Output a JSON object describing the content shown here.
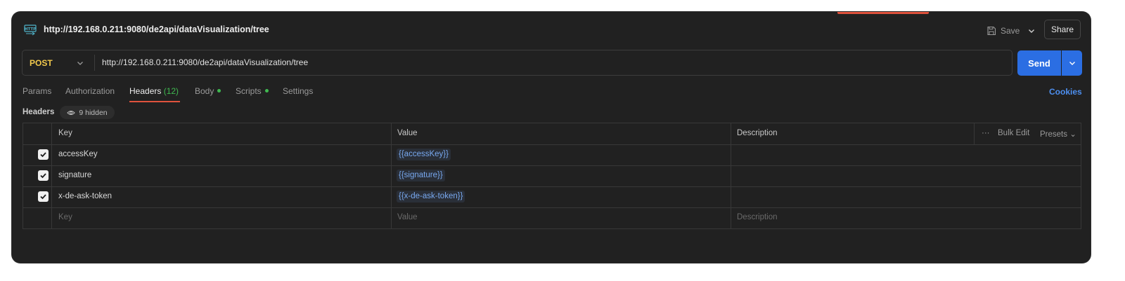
{
  "title": "http://192.168.0.211:9080/de2api/dataVisualization/tree",
  "toolbar": {
    "save_label": "Save",
    "share_label": "Share"
  },
  "request": {
    "method": "POST",
    "url": "http://192.168.0.211:9080/de2api/dataVisualization/tree",
    "send_label": "Send"
  },
  "tabs": [
    {
      "label": "Params"
    },
    {
      "label": "Authorization"
    },
    {
      "label": "Headers",
      "count": "(12)",
      "active": true
    },
    {
      "label": "Body",
      "dot": true
    },
    {
      "label": "Scripts",
      "dot": true
    },
    {
      "label": "Settings"
    }
  ],
  "cookies_label": "Cookies",
  "headers_section": {
    "label": "Headers",
    "hidden_label": "9 hidden"
  },
  "table": {
    "columns": {
      "key": "Key",
      "value": "Value",
      "description": "Description"
    },
    "tools": {
      "bulk_edit": "Bulk Edit",
      "presets": "Presets"
    },
    "rows": [
      {
        "checked": true,
        "key": "accessKey",
        "value": "{{accessKey}}"
      },
      {
        "checked": true,
        "key": "signature",
        "value": "{{signature}}"
      },
      {
        "checked": true,
        "key": "x-de-ask-token",
        "value": "{{x-de-ask-token}}"
      }
    ],
    "placeholders": {
      "key": "Key",
      "value": "Value",
      "description": "Description"
    }
  },
  "colors": {
    "background": "#212121",
    "accent": "#e0533d",
    "send": "#2b6ee3",
    "method": "#f2c94c",
    "status_dot": "#3fb950",
    "variable": "#78a9f0"
  }
}
